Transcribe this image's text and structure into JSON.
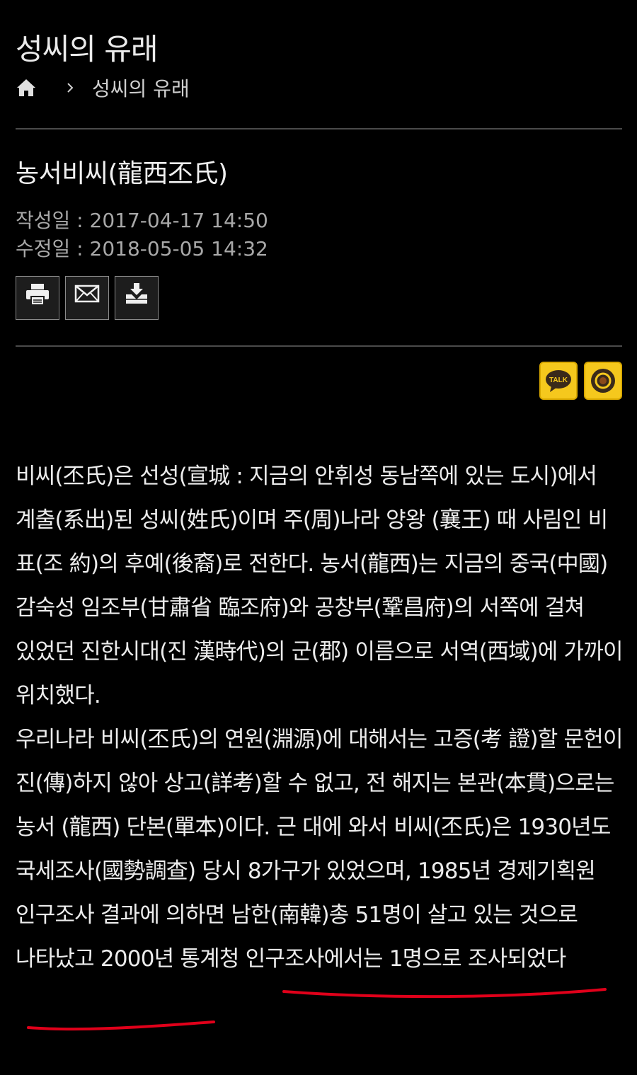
{
  "header": {
    "title": "성씨의 유래",
    "breadcrumb": {
      "home_icon": "home-icon",
      "separator_icon": "chevron-right-icon",
      "current": "성씨의 유래"
    }
  },
  "article": {
    "title": "농서비씨(龍西丕氏)",
    "created_label": "작성일 : 2017-04-17 14:50",
    "modified_label": "수정일 : 2018-05-05 14:32",
    "tools": [
      {
        "icon": "printer-icon"
      },
      {
        "icon": "mail-icon"
      },
      {
        "icon": "download-icon"
      }
    ],
    "share": [
      {
        "icon": "kakaotalk-icon",
        "label": "TALK",
        "color": "#f5c81d"
      },
      {
        "icon": "kakaostory-icon",
        "color": "#f5c81d"
      }
    ],
    "paragraphs": [
      "비씨(丕氏)은 선성(宣城 : 지금의 안휘성 동남쪽에 있는 도시)에서 계출(系出)된 성씨(姓氏)이며 주(周)나라 양왕 (襄王) 때 사림인 비 표(조 約)의 후예(後裔)로 전한다. 농서(龍西)는 지금의 중국(中國) 감숙성 임조부(甘肅省 臨조府)와 공창부(鞏昌府)의 서쪽에 걸쳐 있었던 진한시대(진 漢時代)의 군(郡) 이름으로 서역(西域)에 가까이 위치했다.",
      "우리나라 비씨(丕氏)의 연원(淵源)에 대해서는 고증(考 證)할 문헌이 진(傳)하지 않아 상고(詳考)할 수 없고, 전 해지는 본관(本貫)으로는 농서 (龍西) 단본(單本)이다. 근 대에 와서 비씨(丕氏)은 1930년도 국세조사(國勢調查) 당시 8가구가 있었으며, 1985년 경제기획원 인구조사 결과에 의하면 남한(南韓)총 51명이 살고 있는 것으로 나타났고 2000년 통계청 인구조사에서는 1명으로 조사되었다"
    ]
  },
  "colors": {
    "background": "#000000",
    "share_accent": "#f5c81d",
    "annotation": "#e0001a"
  }
}
